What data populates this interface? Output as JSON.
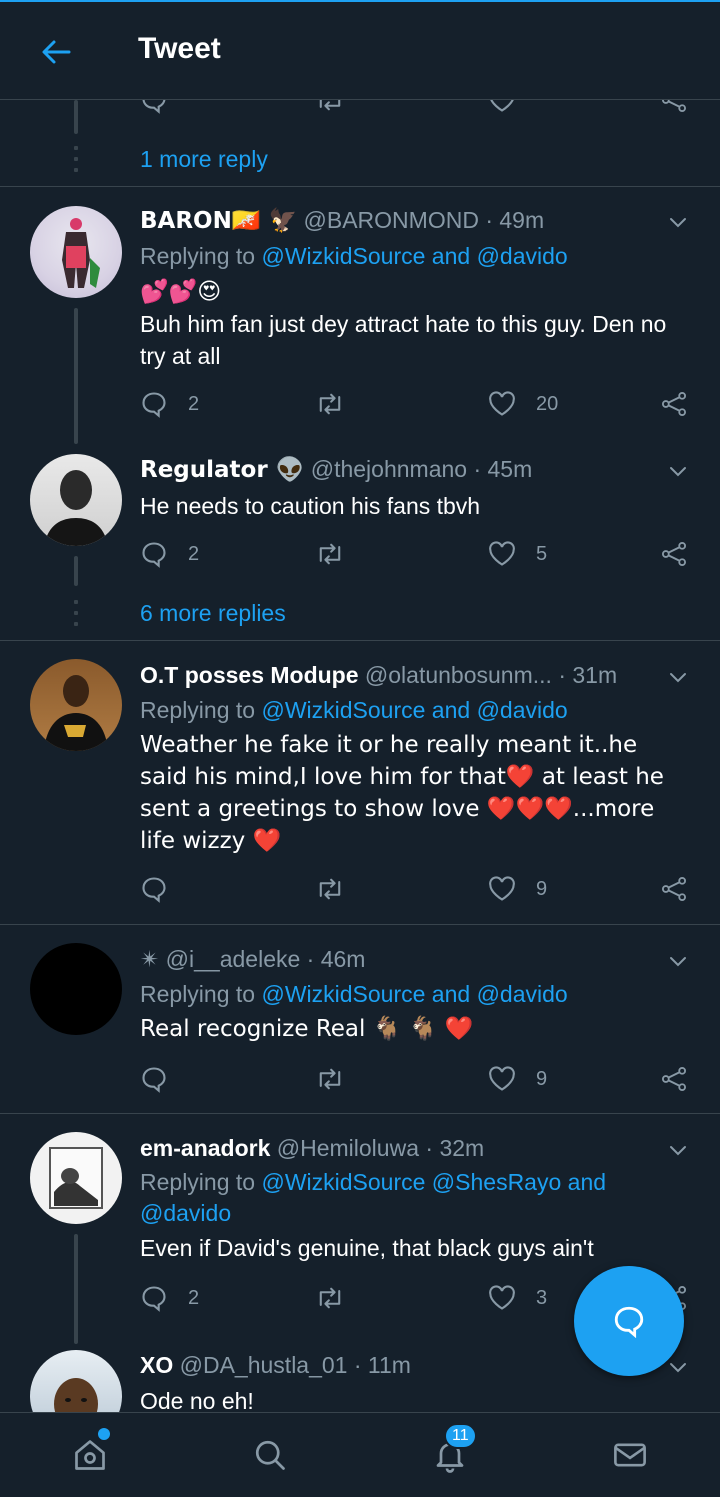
{
  "header": {
    "title": "Tweet"
  },
  "more_reply_1": "1 more reply",
  "more_reply_2": "6 more replies",
  "tweets": [
    {
      "name": "BARON🇧🇹 🦅",
      "handle": "@BARONMOND",
      "time": "· 49m",
      "replying_prefix": "Replying to",
      "replying_to": "@WizkidSource and @davido",
      "text_line1": "💕💕😍",
      "text_line2": "Buh him fan just dey attract hate to this guy. Den no try at all",
      "replies": "2",
      "retweets": "",
      "likes": "20"
    },
    {
      "name": "Regulator 👽",
      "handle": "@thejohnmano",
      "time": "· 45m",
      "text": "He needs to caution his fans tbvh",
      "replies": "2",
      "retweets": "",
      "likes": "5"
    },
    {
      "name": "O.T posses Modupe",
      "handle": "@olatunbosunm...",
      "time": "· 31m",
      "replying_prefix": "Replying to",
      "replying_to": "@WizkidSource and @davido",
      "text": "Weather he fake it or he really meant it..he said his mind,I love him for that❤️ at least he sent a greetings to show love ❤️❤️❤️...more life wizzy ❤️",
      "replies": "",
      "retweets": "",
      "likes": "9"
    },
    {
      "name": "✴",
      "handle": "@i__adeleke",
      "time": "· 46m",
      "replying_prefix": "Replying to",
      "replying_to": "@WizkidSource and @davido",
      "text": "Real recognize Real 🐐 🐐 ❤️",
      "replies": "",
      "retweets": "",
      "likes": "9"
    },
    {
      "name": "em-anadork",
      "handle": "@Hemiloluwa",
      "time": "· 32m",
      "replying_prefix": "Replying to",
      "replying_to": "@WizkidSource @ShesRayo and @davido",
      "text": "Even if David's genuine, that black guys ain't",
      "replies": "2",
      "retweets": "",
      "likes": "3"
    },
    {
      "name": "XO",
      "handle": "@DA_hustla_01",
      "time": "· 11m",
      "text": "Ode no eh!"
    }
  ],
  "nav": {
    "notifications_badge": "11"
  },
  "colors": {
    "background": "#15202b",
    "accent": "#1da1f2",
    "muted": "#8899a6",
    "border": "#38444d"
  }
}
